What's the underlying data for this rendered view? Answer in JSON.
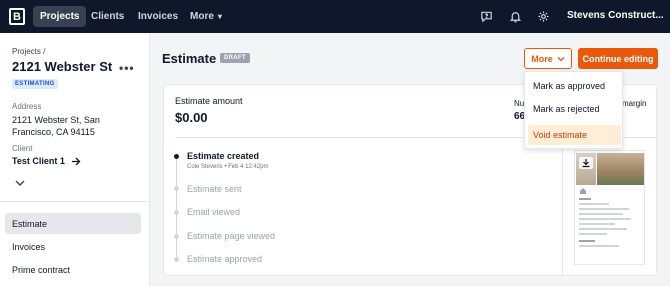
{
  "topbar": {
    "logo": "B",
    "nav": [
      {
        "label": "Projects"
      },
      {
        "label": "Clients"
      },
      {
        "label": "Invoices"
      },
      {
        "label": "More"
      }
    ],
    "company": "Stevens Construct..."
  },
  "sidebar": {
    "breadcrumb": "Projects /",
    "title": "2121 Webster St",
    "status": "ESTIMATING",
    "address_label": "Address",
    "address_line1": "2121 Webster St, San",
    "address_line2": "Francisco, CA 94115",
    "client_label": "Client",
    "client_name": "Test Client 1",
    "items": [
      {
        "label": "Estimate"
      },
      {
        "label": "Invoices"
      },
      {
        "label": "Prime contract"
      }
    ]
  },
  "main": {
    "title": "Estimate",
    "status_badge": "DRAFT",
    "more_label": "More",
    "continue_label": "Continue editing",
    "amount_label": "Estimate amount",
    "amount_value": "$0.00",
    "partial_col1_label": "Nu",
    "partial_col1_value": "66",
    "partial_col2_label": "margin",
    "timeline": [
      {
        "label": "Estimate created",
        "meta": "Cole Stevens • Feb 4 12:42pm",
        "done": true
      },
      {
        "label": "Estimate sent",
        "done": false
      },
      {
        "label": "Email viewed",
        "done": false
      },
      {
        "label": "Estimate page viewed",
        "done": false
      },
      {
        "label": "Estimate approved",
        "done": false
      }
    ]
  },
  "dropdown": {
    "items": [
      {
        "label": "Mark as approved"
      },
      {
        "label": "Mark as rejected"
      },
      {
        "label": "Void estimate"
      }
    ]
  },
  "colors": {
    "topbar": "#0f172a",
    "accent": "#ea580c",
    "highlight": "#ffedd5"
  }
}
